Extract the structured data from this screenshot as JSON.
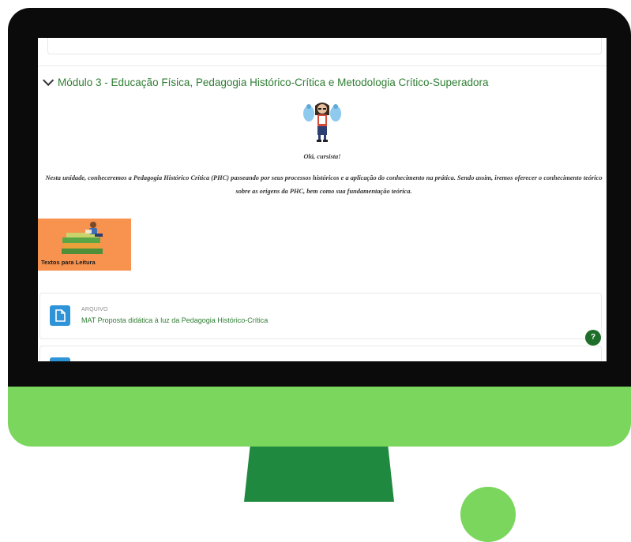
{
  "colors": {
    "bezel": "#0b0b0b",
    "chin": "#7ad65c",
    "stand": "#1f8a3f",
    "link_green": "#2e7d32",
    "file_icon_blue": "#2f93d8",
    "banner_orange": "#f8924f",
    "help_green": "#1f6d2a"
  },
  "section": {
    "title": "Módulo 3 - Educação Física, Pedagogia Histórico-Crítica e Metodologia Crítico-Superadora",
    "expand_icon": "chevron-down-icon"
  },
  "content": {
    "greeting": "Olá, cursista!",
    "intro": "Nesta unidade, conheceremos a Pedagogia Histórico Crítica (PHC) passeando por seus processos históricos e a aplicação do conhecimento na prática. Sendo assim, iremos oferecer o conhecimento teórico sobre as origens da PHC, bem como sua fundamentação teórica."
  },
  "banner": {
    "label": "Textos para Leitura"
  },
  "activities": [
    {
      "type": "ARQUIVO",
      "title": "MAT Proposta didática à luz da Pedagogia Histórico-Crítica",
      "icon": "file-icon"
    }
  ],
  "help_button": {
    "label": "?"
  }
}
